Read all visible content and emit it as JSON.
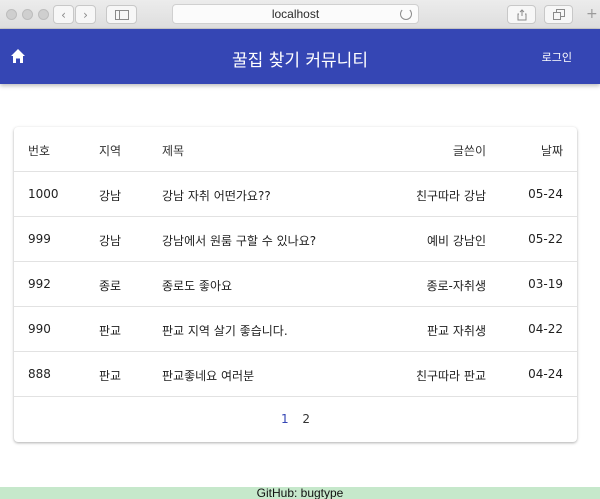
{
  "browser": {
    "url": "localhost"
  },
  "header": {
    "title": "꿀집 찾기 커뮤니티",
    "login_label": "로그인"
  },
  "table": {
    "columns": {
      "num": "번호",
      "area": "지역",
      "title": "제목",
      "author": "글쓴이",
      "date": "날짜"
    },
    "rows": [
      {
        "num": "1000",
        "area": "강남",
        "title": "강남 자취 어떤가요??",
        "author": "친구따라 강남",
        "date": "05-24"
      },
      {
        "num": "999",
        "area": "강남",
        "title": "강남에서 원룸 구할 수 있나요?",
        "author": "예비 강남인",
        "date": "05-22"
      },
      {
        "num": "992",
        "area": "종로",
        "title": "종로도 좋아요",
        "author": "종로-자취생",
        "date": "03-19"
      },
      {
        "num": "990",
        "area": "판교",
        "title": "판교 지역 살기 좋습니다.",
        "author": "판교 자취생",
        "date": "04-22"
      },
      {
        "num": "888",
        "area": "판교",
        "title": "판교좋네요 여러분",
        "author": "친구따라 판교",
        "date": "04-24"
      }
    ]
  },
  "pagination": {
    "pages": [
      "1",
      "2"
    ],
    "active": "1"
  },
  "footer": {
    "text": "GitHub: bugtype"
  },
  "colors": {
    "appbar": "#3546b4",
    "footer": "#c6e8cb",
    "active_page": "#3546b4"
  }
}
